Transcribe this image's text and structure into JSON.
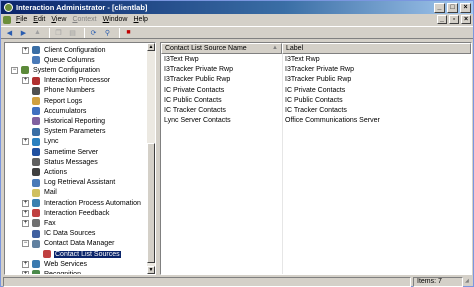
{
  "window": {
    "title": "Interaction Administrator - [clientlab]",
    "controls": [
      "_",
      "□",
      "×"
    ]
  },
  "menubar": {
    "items": [
      {
        "ul": "F",
        "rest": "ile"
      },
      {
        "ul": "E",
        "rest": "dit"
      },
      {
        "ul": "V",
        "rest": "iew"
      },
      {
        "ul": "C",
        "rest": "ontext",
        "disabled": true
      },
      {
        "ul": "W",
        "rest": "indow"
      },
      {
        "ul": "H",
        "rest": "elp"
      }
    ],
    "window_controls": [
      "_",
      "▫",
      "×"
    ]
  },
  "toolbar": {
    "icons": [
      "back-icon",
      "forward-icon",
      "up-icon",
      "copy-icon",
      "paste-icon",
      "properties-icon",
      "refresh-icon",
      "filter-icon",
      "delete-icon"
    ]
  },
  "tree": {
    "items": [
      {
        "label": "Client Configuration",
        "expander": "+",
        "indent": 1,
        "color": "#3a6ea5"
      },
      {
        "label": "Queue Columns",
        "expander": "",
        "indent": 1,
        "color": "#4a7ab8"
      },
      {
        "label": "System Configuration",
        "expander": "−",
        "indent": 0,
        "color": "#5c8a3a"
      },
      {
        "label": "Interaction Processor",
        "expander": "+",
        "indent": 1,
        "color": "#b03030"
      },
      {
        "label": "Phone Numbers",
        "expander": "",
        "indent": 1,
        "color": "#505050"
      },
      {
        "label": "Report Logs",
        "expander": "",
        "indent": 1,
        "color": "#d0a040"
      },
      {
        "label": "Accumulators",
        "expander": "",
        "indent": 1,
        "color": "#4070c0"
      },
      {
        "label": "Historical Reporting",
        "expander": "",
        "indent": 1,
        "color": "#8060a0"
      },
      {
        "label": "System Parameters",
        "expander": "",
        "indent": 1,
        "color": "#3a6ea5"
      },
      {
        "label": "Lync",
        "expander": "+",
        "indent": 1,
        "color": "#2a80c0"
      },
      {
        "label": "Sametime Server",
        "expander": "",
        "indent": 1,
        "color": "#2050a0"
      },
      {
        "label": "Status Messages",
        "expander": "",
        "indent": 1,
        "color": "#606060"
      },
      {
        "label": "Actions",
        "expander": "",
        "indent": 1,
        "color": "#404040"
      },
      {
        "label": "Log Retrieval Assistant",
        "expander": "",
        "indent": 1,
        "color": "#4a7ab8"
      },
      {
        "label": "Mail",
        "expander": "",
        "indent": 1,
        "color": "#d0c060"
      },
      {
        "label": "Interaction Process Automation",
        "expander": "+",
        "indent": 1,
        "color": "#3a80b0"
      },
      {
        "label": "Interaction Feedback",
        "expander": "+",
        "indent": 1,
        "color": "#c04040"
      },
      {
        "label": "Fax",
        "expander": "+",
        "indent": 1,
        "color": "#707070"
      },
      {
        "label": "IC Data Sources",
        "expander": "",
        "indent": 1,
        "color": "#4060a0"
      },
      {
        "label": "Contact Data Manager",
        "expander": "−",
        "indent": 1,
        "color": "#6080a0"
      },
      {
        "label": "Contact List Sources",
        "expander": "",
        "indent": 2,
        "color": "#c04040",
        "selected": true
      },
      {
        "label": "Web Services",
        "expander": "+",
        "indent": 1,
        "color": "#3a7ab0"
      },
      {
        "label": "Recognition",
        "expander": "+",
        "indent": 1,
        "color": "#4a8a4a"
      }
    ]
  },
  "list": {
    "columns": [
      "Contact List Source Name",
      "Label"
    ],
    "rows": [
      [
        "I3Text Rwp",
        "I3Text Rwp"
      ],
      [
        "I3Tracker Private Rwp",
        "I3Tracker Private Rwp"
      ],
      [
        "I3Tracker Public Rwp",
        "I3Tracker Public Rwp"
      ],
      [
        "IC Private Contacts",
        "IC Private Contacts"
      ],
      [
        "IC Public Contacts",
        "IC Public Contacts"
      ],
      [
        "IC Tracker Contacts",
        "IC Tracker Contacts"
      ],
      [
        "Lync Server Contacts",
        "Office Communications Server"
      ]
    ]
  },
  "statusbar": {
    "items_count": "Items: 7"
  }
}
